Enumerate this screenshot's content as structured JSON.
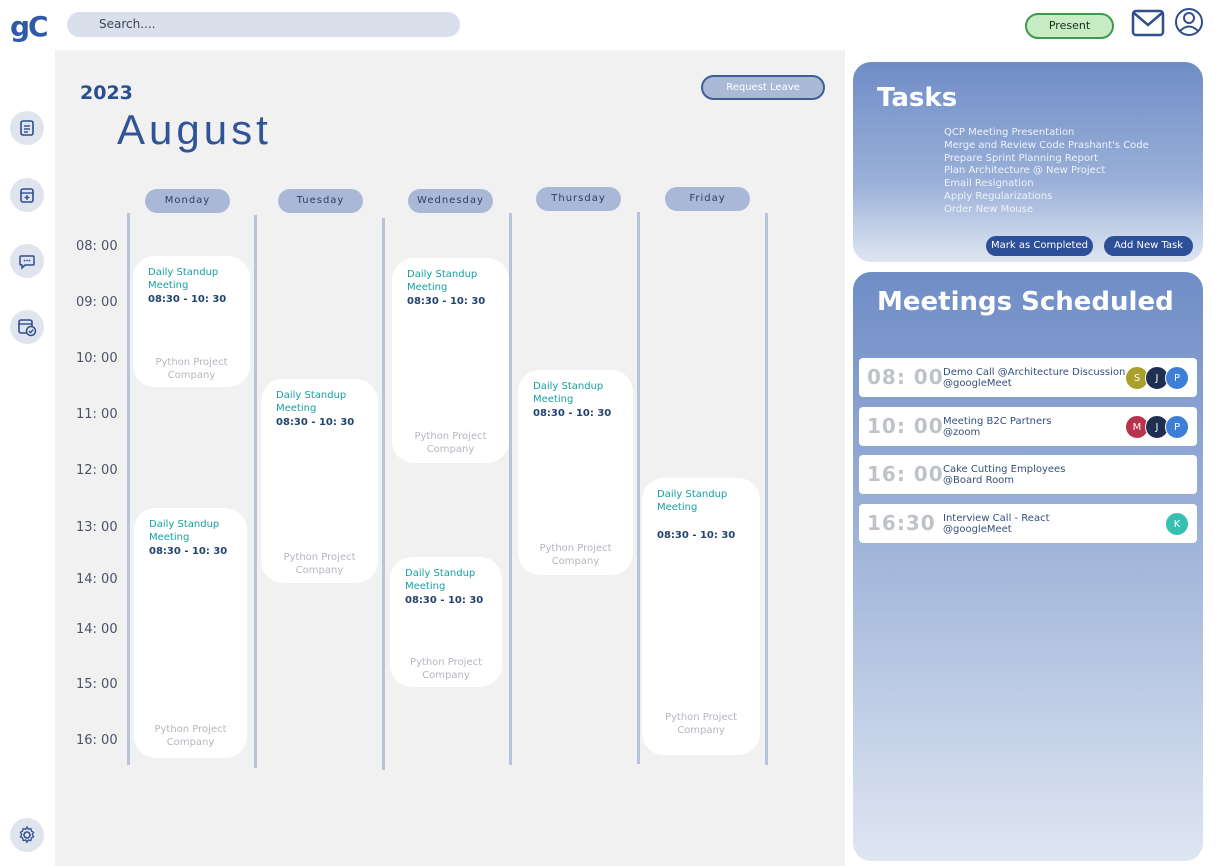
{
  "app": {
    "logo": "gC"
  },
  "search": {
    "placeholder": "Search...."
  },
  "header": {
    "status": "Present"
  },
  "calendar": {
    "year": "2023",
    "month": "August",
    "request_leave": "Request Leave",
    "days": [
      "Monday",
      "Tuesday",
      "Wednesday",
      "Thursday",
      "Friday"
    ],
    "times": [
      "08: 00",
      "09: 00",
      "10: 00",
      "11: 00",
      "12: 00",
      "13: 00",
      "14: 00",
      "14: 00",
      "15: 00",
      "16: 00"
    ],
    "events": [
      {
        "title": "Daily Standup Meeting",
        "time": "08:30 - 10: 30",
        "project": "Python Project",
        "company": "Company"
      },
      {
        "title": "Daily Standup Meeting",
        "time": "08:30 - 10: 30",
        "project": "Python Project",
        "company": "Company"
      },
      {
        "title": "Daily Standup Meeting",
        "time": "08:30 - 10: 30",
        "project": "Python Project",
        "company": "Company"
      },
      {
        "title": "Daily Standup Meeting",
        "time": "08:30 - 10: 30",
        "project": "Python Project",
        "company": "Company"
      },
      {
        "title": "Daily Standup Meeting",
        "time": "08:30 - 10: 30",
        "project": "Python Project",
        "company": "Company"
      },
      {
        "title": "Daily Standup Meeting",
        "time": "08:30 - 10: 30",
        "project": "Python Project",
        "company": "Company"
      },
      {
        "title": "Daily Standup Meeting",
        "time": "08:30 - 10: 30",
        "project": "Python Project",
        "company": "Company"
      }
    ]
  },
  "tasks": {
    "title": "Tasks",
    "items": [
      "QCP Meeting Presentation",
      "Merge and Review Code Prashant's Code",
      "Prepare Sprint Planning Report",
      "Plan Architecture @ New Project",
      "Email Resignation",
      "Apply Regularizations",
      "Order New Mouse"
    ],
    "mark_completed": "Mark as Completed",
    "add_new": "Add New Task"
  },
  "meetings": {
    "title": "Meetings Scheduled",
    "items": [
      {
        "time": "08: 00",
        "name": "Demo Call @Architecture Discussion",
        "venue": "@googleMeet",
        "attendees": [
          "S",
          "J",
          "P"
        ]
      },
      {
        "time": "10: 00",
        "name": "Meeting B2C Partners",
        "venue": "@zoom",
        "attendees": [
          "M",
          "J",
          "P"
        ]
      },
      {
        "time": "16: 00",
        "name": "Cake Cutting Employees",
        "venue": "@Board Room",
        "attendees": []
      },
      {
        "time": "16:30",
        "name": "Interview Call - React",
        "venue": "@googleMeet",
        "attendees": [
          "K"
        ]
      }
    ]
  },
  "colors": {
    "accent": "#2f5aa8",
    "event_title": "#17a0a0",
    "present": "#c7ebc3",
    "avatar_s": "#a8a02a",
    "avatar_j": "#1f2f4f",
    "avatar_p": "#3d7fd6",
    "avatar_m": "#b8334d",
    "avatar_k": "#36c0b0"
  },
  "icons": {
    "search": "search-icon",
    "mail": "mail-icon",
    "user": "user-icon",
    "sidebar": [
      "document-icon",
      "add-calendar-icon",
      "chat-icon",
      "calendar-check-icon"
    ],
    "settings": "gear-icon"
  }
}
